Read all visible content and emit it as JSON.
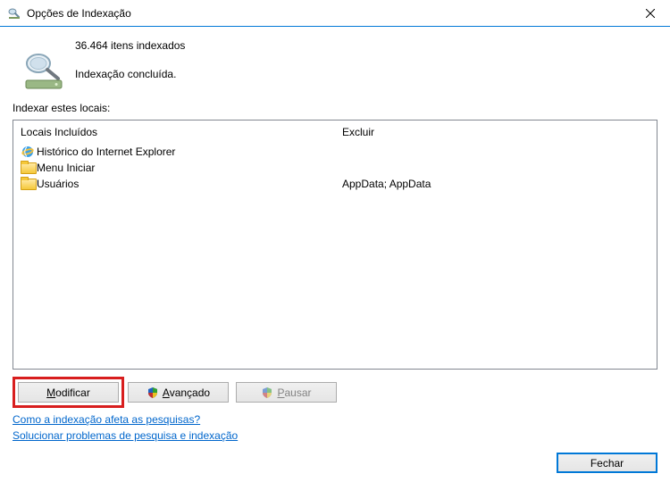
{
  "titlebar": {
    "text": "Opções de Indexação"
  },
  "status": {
    "count_line": "36.464 itens indexados",
    "complete_line": "Indexação concluída."
  },
  "locations_label": "Indexar estes locais:",
  "columns": {
    "included": "Locais Incluídos",
    "exclude": "Excluir"
  },
  "included_items": [
    {
      "label": "Histórico do Internet Explorer"
    },
    {
      "label": "Menu Iniciar"
    },
    {
      "label": "Usuários"
    }
  ],
  "exclude_items": [
    {
      "label": "AppData; AppData"
    }
  ],
  "buttons": {
    "modify": "Modificar",
    "advanced": "Avançado",
    "pause": "Pausar",
    "close": "Fechar"
  },
  "links": {
    "how_affects": "Como a indexação afeta as pesquisas?",
    "troubleshoot": "Solucionar problemas de pesquisa e indexação"
  }
}
